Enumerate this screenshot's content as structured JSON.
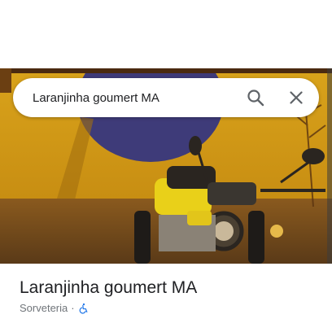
{
  "search": {
    "query": "Laranjinha goumert MA"
  },
  "place": {
    "name": "Laranjinha goumert MA",
    "category": "Sorveteria",
    "separator": "·"
  },
  "photo": {
    "description_icon": "motorcycle-photo",
    "colors": {
      "wall": "#d8a21b",
      "circle": "#3d3a78",
      "ground": "#7a5020"
    }
  },
  "icons": {
    "search": "search-icon",
    "close": "close-icon",
    "accessibility": "wheelchair-icon"
  },
  "colors": {
    "accessibility_blue": "#1a73e8",
    "icon_gray": "#5f6368"
  }
}
